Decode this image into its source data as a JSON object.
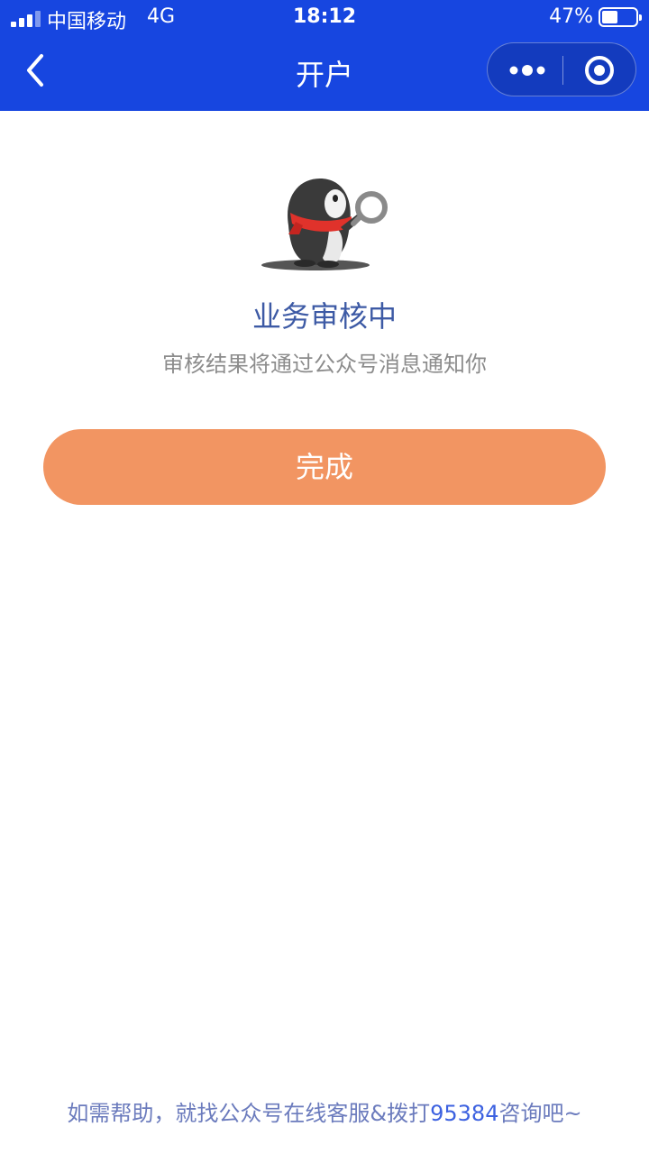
{
  "status_bar": {
    "carrier": "中国移动",
    "network": "4G",
    "time": "18:12",
    "battery_percent": "47%",
    "battery_level": 0.47
  },
  "nav": {
    "back_icon": "chevron-left-icon",
    "title": "开户",
    "more_icon": "more-dots-icon",
    "close_icon": "target-close-icon"
  },
  "main": {
    "illustration": "penguin-magnifier-illustration",
    "heading": "业务审核中",
    "subtitle": "审核结果将通过公众号消息通知你",
    "done_button": "完成"
  },
  "footer": {
    "text_before": "如需帮助，就找公众号在线客服&拨打",
    "phone": "95384",
    "text_after": "咨询吧~"
  },
  "colors": {
    "primary_blue": "#1746e0",
    "button_orange": "#f29562",
    "heading_blue": "#3d5aa5",
    "link_blue": "#3c61e0"
  }
}
